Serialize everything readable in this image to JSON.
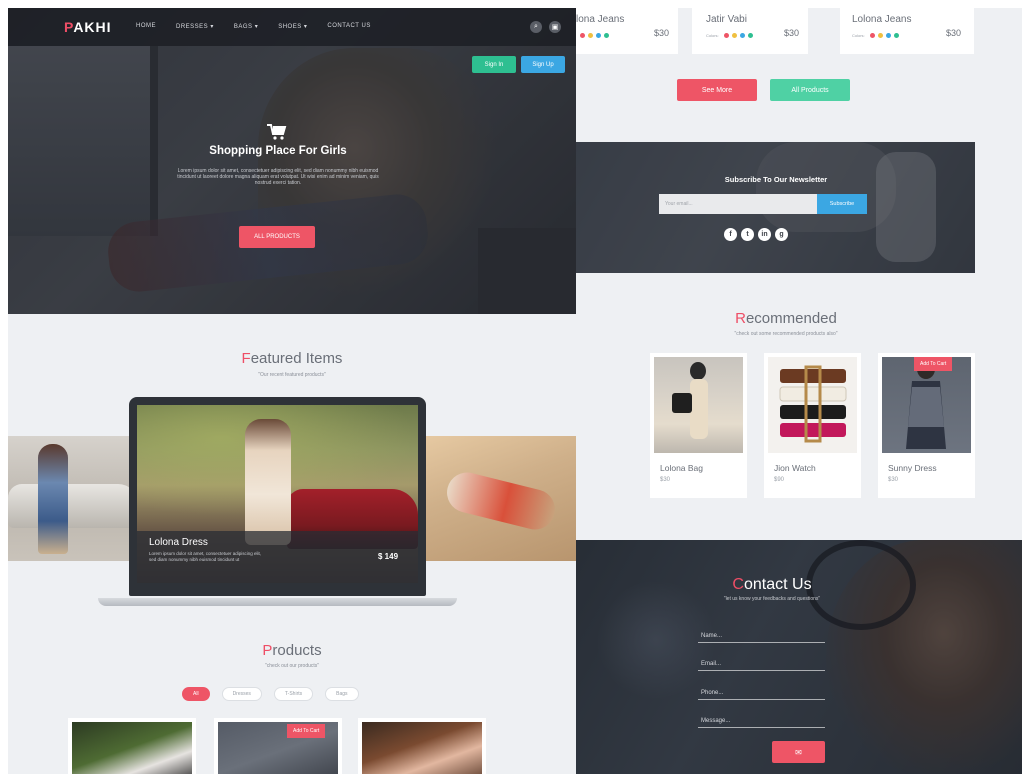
{
  "colors": {
    "accent": "#ee4e66",
    "green": "#2ebf91",
    "blue": "#3ba7e3",
    "dark": "#2e3238"
  },
  "left": {
    "brand": {
      "first": "P",
      "rest": "AKHI"
    },
    "nav": [
      "HOME",
      "DRESSES ▾",
      "BAGS ▾",
      "SHOES ▾",
      "CONTACT US"
    ],
    "search_icon": "⌕",
    "settings_icon": "▣",
    "sign_in": "Sign In",
    "sign_up": "Sign Up",
    "hero": {
      "cart_icon": "🛒",
      "title": "Shopping Place For Girls",
      "text": "Lorem ipsum dolor sit amet, consectetuer adipiscing elit, sed diam nonummy nibh euismod tincidunt ut laoreet dolore magna aliquam erat volutpat. Ut wisi enim ad minim veniam, quis nostrud exerci tation.",
      "button": "ALL PRODUCTS"
    },
    "featured": {
      "title_first": "F",
      "title_rest": "eatured Items",
      "subtitle": "\"Our recent featured products\"",
      "item_name": "Lolona Dress",
      "item_text": "Lorem ipsum dolor sit amet, consectetuer adipiscing elit, sed diam nonummy nibh euismod tincidunt ut",
      "item_price": "$ 149"
    },
    "products": {
      "title_first": "P",
      "title_rest": "roducts",
      "subtitle": "\"check out our products\"",
      "filters": [
        "All",
        "Dresses",
        "T-Shirts",
        "Bags"
      ],
      "add_to_cart": "Add To Cart"
    }
  },
  "right": {
    "top_cards": [
      {
        "name": "lona Jeans",
        "price": "$30"
      },
      {
        "name": "Jatir Vabi",
        "price": "$30"
      },
      {
        "name": "Lolona Jeans",
        "price": "$30"
      }
    ],
    "colors_label": "Colors:",
    "see_more": "See More",
    "all_products": "All Products",
    "newsletter": {
      "title": "Subscribe To Our Newsletter",
      "placeholder": "Your email...",
      "button": "Subscribe",
      "socials": [
        "f",
        "t",
        "in",
        "g"
      ]
    },
    "recommended": {
      "title_first": "R",
      "title_rest": "ecommended",
      "subtitle": "\"check out some recommended products also\"",
      "items": [
        {
          "name": "Lolona Bag",
          "price": "$30"
        },
        {
          "name": "Jion Watch",
          "price": "$90"
        },
        {
          "name": "Sunny Dress",
          "price": "$30"
        }
      ],
      "add_to_cart": "Add To Cart"
    },
    "contact": {
      "title_first": "C",
      "title_rest": "ontact Us",
      "subtitle": "\"let us know your feedbacks and questions\"",
      "name": "Name...",
      "email": "Email...",
      "phone": "Phone...",
      "message": "Message...",
      "send_icon": "✉"
    }
  }
}
